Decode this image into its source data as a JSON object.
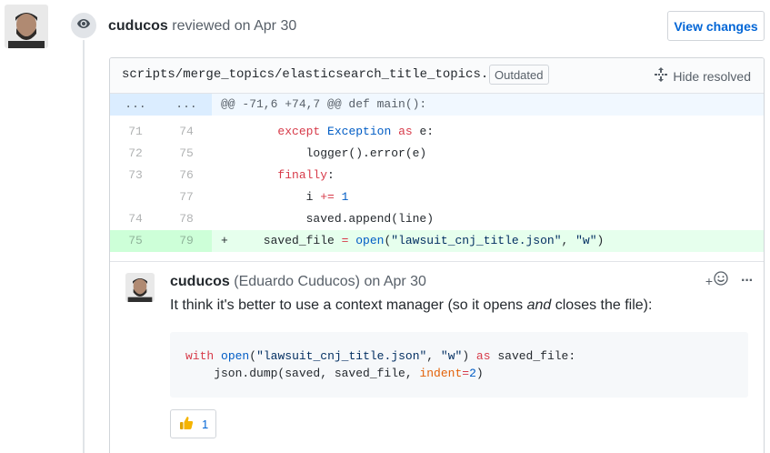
{
  "review": {
    "author": "cuducos",
    "action": "reviewed on",
    "date": "Apr 30",
    "view_changes_label": "View changes"
  },
  "file": {
    "path": "scripts/merge_topics/elasticsearch_title_topics.py",
    "outdated_label": "Outdated",
    "hide_resolved_label": "Hide resolved"
  },
  "diff": {
    "hunk": {
      "old": "...",
      "new": "...",
      "text": "@@ -71,6 +74,7 @@ def main():"
    },
    "lines": [
      {
        "old": "71",
        "new": "74"
      },
      {
        "old": "72",
        "new": "75"
      },
      {
        "old": "73",
        "new": "76"
      },
      {
        "old": "",
        "new": "77"
      },
      {
        "old": "74",
        "new": "78"
      },
      {
        "old": "75",
        "new": "79"
      }
    ],
    "code": {
      "l1_indent": "        ",
      "l1_kw": "except",
      "l1_cls": "Exception",
      "l1_as": "as",
      "l1_rest": " e:",
      "l2": "            logger().error(e)",
      "l3_indent": "        ",
      "l3_kw": "finally",
      "l3_rest": ":",
      "l4_indent": "            i ",
      "l4_op": "+=",
      "l4_num": "1",
      "l5": "            saved.append(line)",
      "l6_prefix": "+     saved_file ",
      "l6_op": "=",
      "l6_fn": "open",
      "l6_str1": "\"lawsuit_cnj_title.json\"",
      "l6_sep": ", ",
      "l6_str2": "\"w\"",
      "l6_end": ")"
    }
  },
  "comment": {
    "author": "cuducos",
    "fullname": "(Eduardo Cuducos)",
    "on_label": "on",
    "date": "Apr 30",
    "text_before": "It think it's better to use a context manager (so it opens ",
    "text_em": "and",
    "text_after": " closes the file):",
    "add_reaction_label": "+",
    "more_label": "···",
    "code": {
      "kw_with": "with",
      "fn_open": "open",
      "str1": "\"lawsuit_cnj_title.json\"",
      "str2": "\"w\"",
      "kw_as": "as",
      "var": "saved_file:",
      "line2_pre": "    json.dump(saved, saved_file, ",
      "arg": "indent",
      "eq": "=",
      "num": "2",
      "close": ")"
    },
    "reaction_count": "1"
  },
  "icons": {
    "eye": "eye-icon",
    "unfold": "unfold-icon",
    "smiley": "smiley-icon",
    "kebab": "kebab-horizontal-icon",
    "thumbsup": "thumbsup-icon"
  },
  "colors": {
    "link": "#0366d6",
    "keyword": "#d73a49",
    "builtin": "#005cc5",
    "string": "#032f62",
    "arg": "#e36209",
    "added_bg": "#e6ffed",
    "hunk_bg": "#f1f8ff"
  }
}
